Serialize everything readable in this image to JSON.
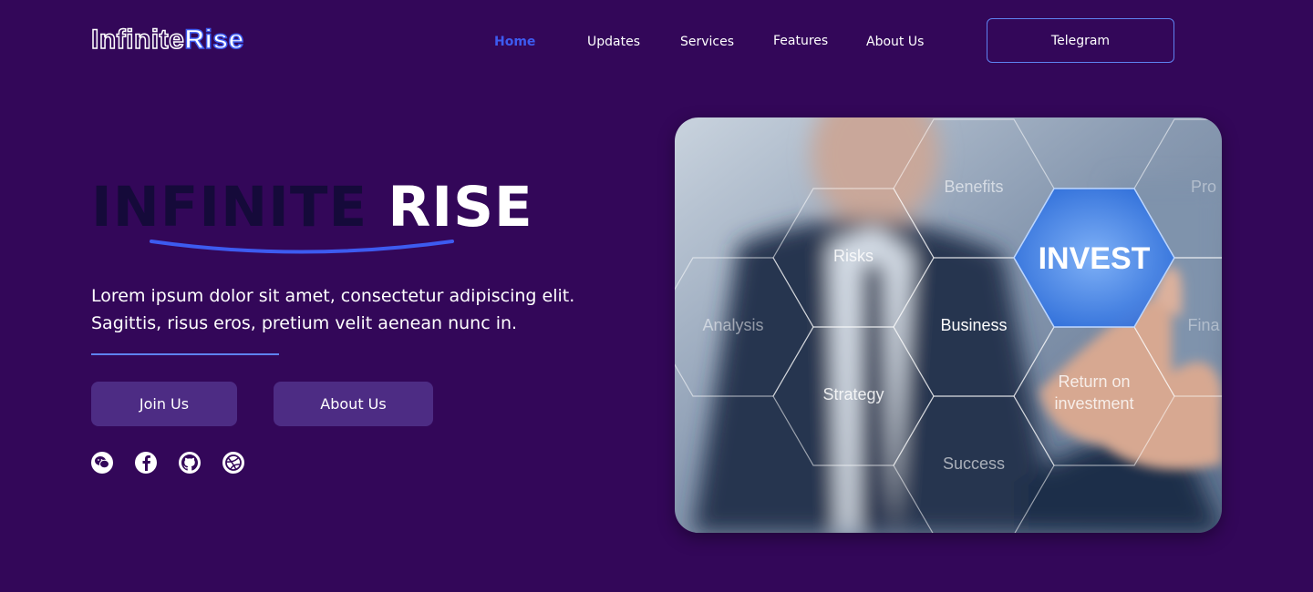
{
  "header": {
    "logo": {
      "part1": "Infinite",
      "part2": "Rise"
    },
    "nav": [
      {
        "label": "Home",
        "active": true
      },
      {
        "label": "Updates"
      },
      {
        "label": "Services"
      },
      {
        "label": "Features"
      },
      {
        "label": "About Us"
      }
    ],
    "cta_label": "Telegram"
  },
  "hero": {
    "title_part1": "INFINITE",
    "title_part2": "RISE",
    "description_line1": "Lorem ipsum dolor sit amet, consectetur adipiscing elit.",
    "description_line2": "Sagittis, risus eros, pretium velit aenean nunc in.",
    "buttons": {
      "join": "Join Us",
      "about": "About Us"
    },
    "social_icons": [
      "wechat-icon",
      "facebook-icon",
      "github-icon",
      "dribbble-icon"
    ]
  },
  "image": {
    "hex_labels": [
      "Benefits",
      "Risks",
      "INVEST",
      "Analysis",
      "Business",
      "Strategy",
      "Return on",
      "investment",
      "Success",
      "Pro",
      "Fina"
    ]
  },
  "colors": {
    "background": "#330759",
    "accent": "#3d5bf0",
    "button": "#4d2c84",
    "outline": "#5e82f0"
  }
}
